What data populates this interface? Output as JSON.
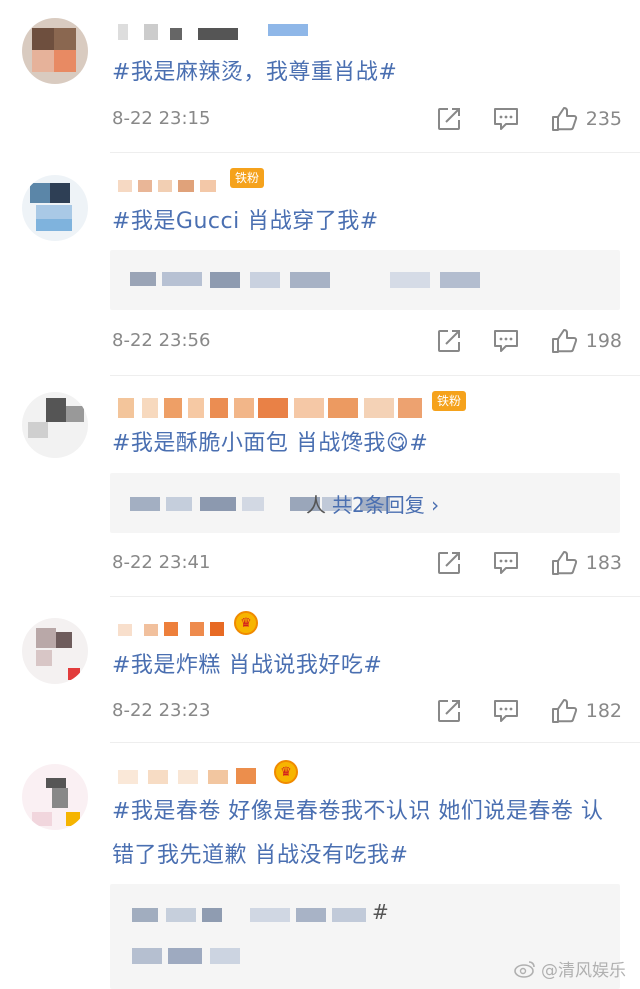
{
  "comments": [
    {
      "topic": "#我是麻辣烫，我尊重肖战#",
      "time": "8-22 23:15",
      "likes": "235"
    },
    {
      "topic": "#我是Gucci 肖战穿了我#",
      "time": "8-22 23:56",
      "likes": "198",
      "badge": "铁粉"
    },
    {
      "topic": "#我是酥脆小面包 肖战馋我😋#",
      "time": "8-22 23:41",
      "likes": "183",
      "badge": "铁粉",
      "reply_suffix": "人",
      "reply_link": "共2条回复 ›"
    },
    {
      "topic": "#我是炸糕 肖战说我好吃#",
      "time": "8-22 23:23",
      "likes": "182"
    },
    {
      "topic": "#我是春卷  好像是春卷我不认识  她们说是春卷 认错了我先道歉  肖战没有吃我#",
      "reply_hash": "#"
    }
  ],
  "watermark": "@清风娱乐",
  "icons": [
    "share-icon",
    "comment-icon",
    "like-icon",
    "crown-icon",
    "weibo-icon"
  ]
}
